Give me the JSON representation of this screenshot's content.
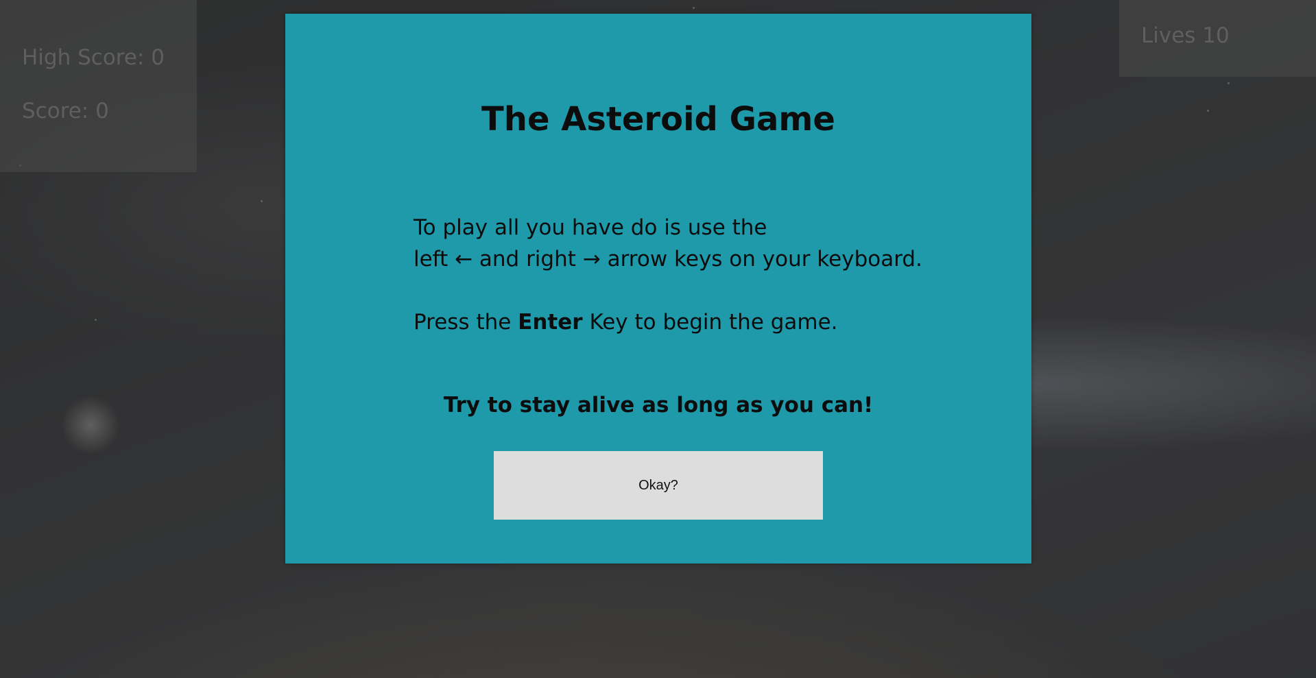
{
  "hud": {
    "high_score_label": "High Score: 0",
    "score_label": "Score: 0",
    "lives_label": "Lives 10"
  },
  "modal": {
    "title": "The Asteroid Game",
    "instructions_line1": "To play all you have do is use the",
    "instructions_line2": "left ← and right → arrow keys on your keyboard.",
    "press_prefix": "Press the",
    "press_key": "Enter",
    "press_suffix": "Key to begin the game.",
    "tagline": "Try to stay alive as long as you can!",
    "okay_button_label": "Okay?"
  },
  "colors": {
    "modal_background": "#1f9aab",
    "button_background": "#dddddd",
    "overlay": "#3c3c3c",
    "hud_text": "#5f5f5f"
  }
}
